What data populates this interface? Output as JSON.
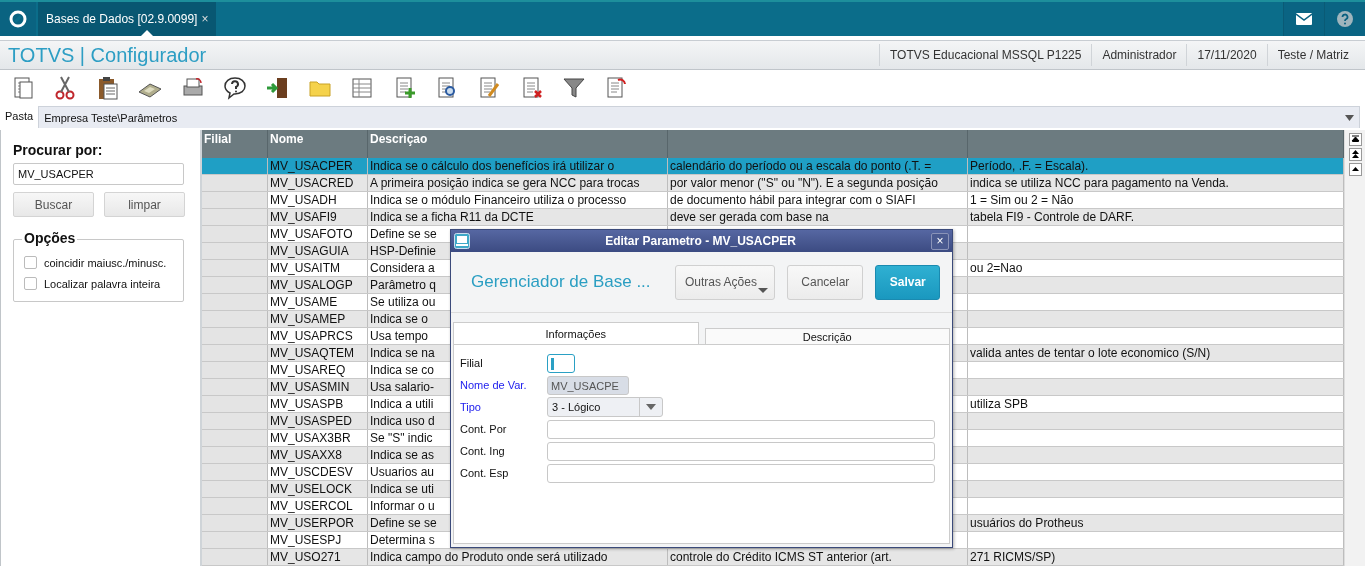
{
  "app": {
    "tab": {
      "label": "Bases de Dados [02.9.0099]",
      "close": "×",
      "selected": true
    },
    "title": "TOTVS | Configurador",
    "status": [
      "TOTVS Educacional MSSQL P1225",
      "Administrador",
      "17/11/2020",
      "Teste / Matriz"
    ]
  },
  "folder": {
    "label": "Pasta",
    "path": "Empresa Teste\\Parâmetros"
  },
  "search": {
    "title": "Procurar por:",
    "value": "MV_USACPER",
    "buttons": [
      "Buscar",
      "limpar"
    ],
    "options_title": "Opções",
    "options": [
      {
        "label": "coincidir maiusc./minusc.",
        "checked": false
      },
      {
        "label": "Localizar palavra inteira",
        "checked": false
      }
    ]
  },
  "table": {
    "columns": [
      "Filial",
      "Nome",
      "Descriçao"
    ],
    "rows": [
      {
        "nome": "MV_USACPER",
        "descricao": "Indica se o cálculo dos benefícios irá utilizar o",
        "column_4": "calendário do período ou a escala do ponto (.T. =",
        "column_5": "Período, .F. = Escala).",
        "selected": true
      },
      {
        "nome": "MV_USACRED",
        "descricao": "A primeira posição indica se gera NCC para trocas",
        "column_4": "por valor menor (\"S\" ou \"N\"). E a segunda posição",
        "column_5": "indica se utiliza NCC para pagamento na Venda.",
        "selected": false
      },
      {
        "nome": "MV_USADH",
        "descricao": "Indica se o módulo Financeiro utiliza o processo",
        "column_4": "de documento hábil para integrar com o SIAFI",
        "column_5": "1 = Sim ou 2 = Não",
        "selected": false
      },
      {
        "nome": "MV_USAFI9",
        "descricao": "Indica se a ficha R11 da DCTE",
        "column_4": "deve ser gerada com base na",
        "column_5": "tabela FI9 - Controle de DARF.",
        "selected": false
      },
      {
        "nome": "MV_USAFOTO",
        "descricao": "Define se se",
        "selected": false
      },
      {
        "nome": "MV_USAGUIA",
        "descricao": "HSP-Definie",
        "selected": false
      },
      {
        "nome": "MV_USAITM",
        "descricao": "Considera a",
        "column_5": "ou 2=Nao",
        "selected": false
      },
      {
        "nome": "MV_USALOGP",
        "descricao": "Parâmetro q",
        "selected": false
      },
      {
        "nome": "MV_USAME",
        "descricao": "Se utiliza ou",
        "selected": false
      },
      {
        "nome": "MV_USAMEP",
        "descricao": "Indica se o",
        "selected": false
      },
      {
        "nome": "MV_USAPRCS",
        "descricao": "Usa tempo",
        "selected": false
      },
      {
        "nome": "MV_USAQTEM",
        "descricao": "Indica se na",
        "column_5": "valida antes de tentar o lote economico (S/N)",
        "selected": false
      },
      {
        "nome": "MV_USAREQ",
        "descricao": "Indica se co",
        "selected": false
      },
      {
        "nome": "MV_USASMIN",
        "descricao": "Usa salario-",
        "selected": false
      },
      {
        "nome": "MV_USASPB",
        "descricao": "Indica a utili",
        "column_5": "utiliza SPB",
        "selected": false
      },
      {
        "nome": "MV_USASPED",
        "descricao": "Indica uso d",
        "selected": false
      },
      {
        "nome": "MV_USAX3BR",
        "descricao": "Se \"S\" indic",
        "selected": false
      },
      {
        "nome": "MV_USAXX8",
        "descricao": "Indica se as",
        "selected": false
      },
      {
        "nome": "MV_USCDESV",
        "descricao": "Usuarios au",
        "selected": false
      },
      {
        "nome": "MV_USELOCK",
        "descricao": "Indica se uti",
        "selected": false
      },
      {
        "nome": "MV_USERCOL",
        "descricao": "Informar o u",
        "selected": false
      },
      {
        "nome": "MV_USERPOR",
        "descricao": "Define se se",
        "column_5": "usuários do Protheus",
        "selected": false
      },
      {
        "nome": "MV_USESPJ",
        "descricao": "Determina s",
        "selected": false
      },
      {
        "nome": "MV_USO271",
        "descricao": "Indica campo do Produto onde será utilizado",
        "column_4": "controle do Crédito ICMS ST anterior (art.",
        "column_5": "271 RICMS/SP)",
        "selected": false
      }
    ]
  },
  "dialog": {
    "title": "Editar Parametro - MV_USACPER",
    "close": "×",
    "heading": "Gerenciador de Base ...",
    "buttons": [
      {
        "label": "Outras Ações",
        "kind": "menu"
      },
      {
        "label": "Cancelar",
        "kind": "default"
      },
      {
        "label": "Salvar",
        "kind": "primary"
      }
    ],
    "tabs": [
      {
        "label": "Informações",
        "selected": true
      },
      {
        "label": "Descrição",
        "selected": false
      }
    ],
    "fields": [
      {
        "label": "Filial",
        "kind": "small",
        "required": false,
        "disabled": false,
        "focused": true
      },
      {
        "label": "Nome de Var.",
        "kind": "medium",
        "value": "MV_USACPE",
        "required": true,
        "disabled": true,
        "focused": false
      },
      {
        "label": "Tipo",
        "kind": "select",
        "value": "3 - Lógico",
        "required": true,
        "disabled": false,
        "focused": false
      },
      {
        "label": "Cont. Por",
        "kind": "wide",
        "required": false,
        "disabled": false,
        "focused": false
      },
      {
        "label": "Cont. Ing",
        "kind": "wide",
        "required": false,
        "disabled": false,
        "focused": false
      },
      {
        "label": "Cont. Esp",
        "kind": "wide",
        "required": false,
        "disabled": false,
        "focused": false
      }
    ]
  }
}
